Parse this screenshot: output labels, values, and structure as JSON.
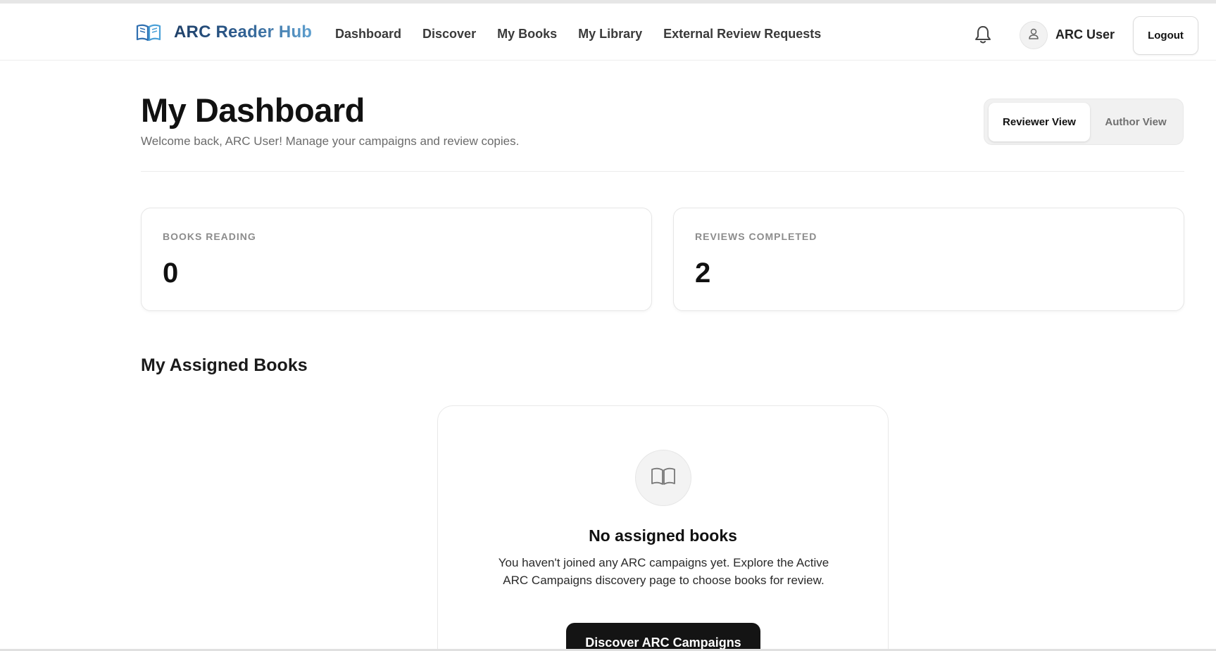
{
  "header": {
    "brand": "ARC Reader Hub",
    "brand_icon": "open-book-icon",
    "nav": [
      "Dashboard",
      "Discover",
      "My Books",
      "My Library",
      "External Review Requests"
    ],
    "notifications_icon": "bell-icon",
    "avatar_icon": "user-icon",
    "username": "ARC User",
    "logout_label": "Logout"
  },
  "page": {
    "title": "My Dashboard",
    "subtitle": "Welcome back, ARC User! Manage your campaigns and review copies.",
    "view_toggle": {
      "options": [
        "Reviewer View",
        "Author View"
      ],
      "selected": "Reviewer View"
    }
  },
  "stats": [
    {
      "label": "BOOKS READING",
      "value": "0"
    },
    {
      "label": "REVIEWS COMPLETED",
      "value": "2"
    }
  ],
  "assigned_books": {
    "heading": "My Assigned Books",
    "empty_state": {
      "icon": "book-open-icon",
      "title": "No assigned books",
      "message": "You haven't joined any ARC campaigns yet. Explore the Active ARC Campaigns discovery page to choose books for review.",
      "cta_label": "Discover ARC Campaigns"
    }
  },
  "colors": {
    "brand_dark": "#1f4068",
    "brand_light": "#5fa0cf",
    "primary_button": "#141414",
    "muted_text": "#6b6b6b"
  }
}
